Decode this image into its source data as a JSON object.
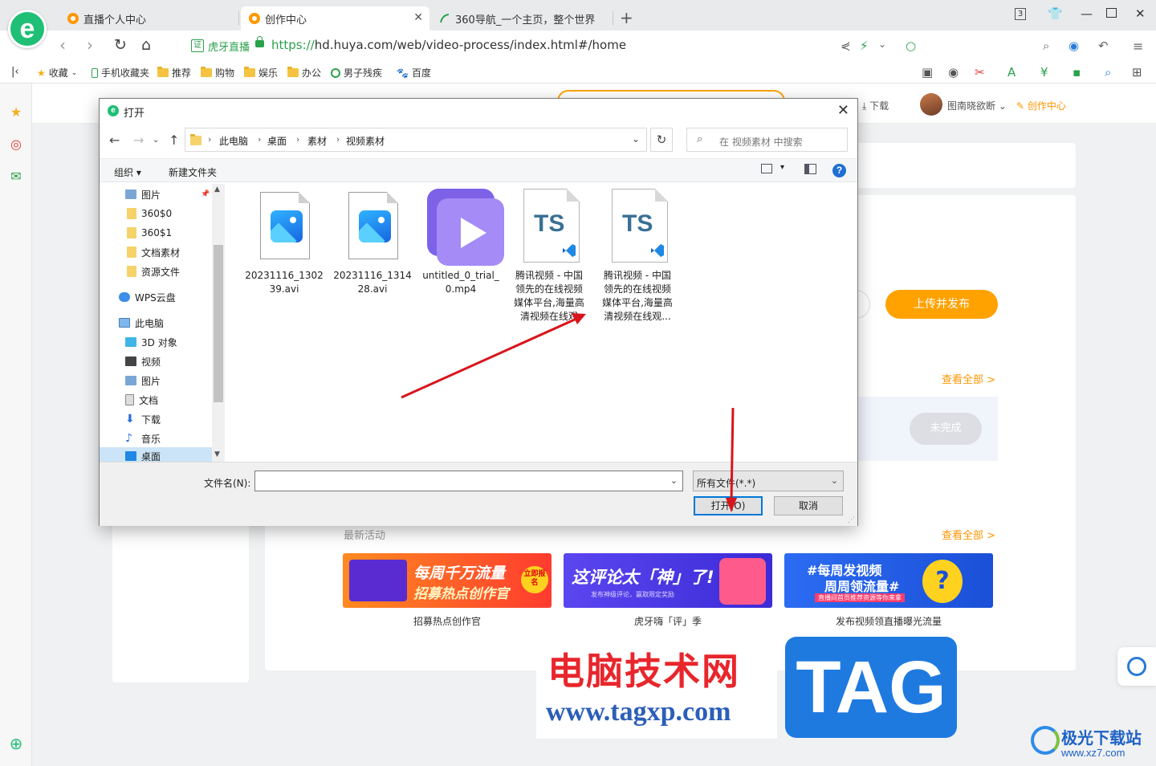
{
  "browser": {
    "tabs": [
      {
        "label": "直播个人中心"
      },
      {
        "label": "创作中心"
      },
      {
        "label": "360导航_一个主页，整个世界"
      }
    ],
    "tab_count": "3",
    "site_label": "虎牙直播",
    "url_protocol": "https://",
    "url_rest": "hd.huya.com/web/video-process/index.html#/home",
    "bookmarks": [
      "收藏",
      "手机收藏夹",
      "推荐",
      "购物",
      "娱乐",
      "办公",
      "男子残疾",
      "百度"
    ]
  },
  "page": {
    "header_links": {
      "download": "下载",
      "user": "图南晓欲断",
      "creator_center": "创作中心"
    },
    "upload_button": "上传并发布",
    "see_all_1": "查看全部 >",
    "see_all_2": "查看全部 >",
    "unfinished": "未完成",
    "latest_activities": "最新活动",
    "banners": [
      {
        "title": "每周千万流量",
        "sub": "招募热点创作官",
        "tag": "立即报名",
        "caption": "招募热点创作官"
      },
      {
        "title": "这评论太「神」了!",
        "sub": "发布神级评论，赢取限定奖励",
        "caption": "虎牙嗨「评」季"
      },
      {
        "title": "#每周发视频",
        "sub": "周周领流量#",
        "extra": "直播间首页推荐资源等你来拿",
        "caption": "发布视频领直播曝光流量"
      }
    ]
  },
  "dialog": {
    "title": "打开",
    "path": [
      "此电脑",
      "桌面",
      "素材",
      "视频素材"
    ],
    "search_placeholder": "在 视频素材 中搜索",
    "toolbar": {
      "organize": "组织",
      "new_folder": "新建文件夹"
    },
    "tree": [
      {
        "label": "图片",
        "icon": "picture-folder"
      },
      {
        "label": "360$0",
        "icon": "folder"
      },
      {
        "label": "360$1",
        "icon": "folder"
      },
      {
        "label": "文档素材",
        "icon": "folder"
      },
      {
        "label": "资源文件",
        "icon": "folder"
      },
      {
        "label": "WPS云盘",
        "icon": "cloud"
      },
      {
        "label": "此电脑",
        "icon": "computer"
      },
      {
        "label": "3D 对象",
        "icon": "3d-objects"
      },
      {
        "label": "视频",
        "icon": "video-folder"
      },
      {
        "label": "图片",
        "icon": "picture-folder"
      },
      {
        "label": "文档",
        "icon": "documents-folder"
      },
      {
        "label": "下载",
        "icon": "download-folder"
      },
      {
        "label": "音乐",
        "icon": "music-folder"
      },
      {
        "label": "桌面",
        "icon": "desktop-folder",
        "selected": true
      }
    ],
    "files": [
      {
        "name_lines": [
          "20231116_1302",
          "39.avi"
        ],
        "type": "image"
      },
      {
        "name_lines": [
          "20231116_1314",
          "28.avi"
        ],
        "type": "image"
      },
      {
        "name_lines": [
          "untitled_0_trial_",
          "0.mp4"
        ],
        "type": "video"
      },
      {
        "name_lines": [
          "腾讯视频 - 中国",
          "领先的在线视频",
          "媒体平台,海量高",
          "清视频在线观"
        ],
        "type": "ts"
      },
      {
        "name_lines": [
          "腾讯视频 - 中国",
          "领先的在线视频",
          "媒体平台,海量高",
          "清视频在线观..."
        ],
        "type": "ts"
      }
    ],
    "filename_label": "文件名(N):",
    "filename_value": "",
    "filetype": "所有文件(*.*)",
    "open_button": "打开(O)",
    "cancel_button": "取消"
  },
  "watermark": {
    "cn": "电脑技术网",
    "url": "www.tagxp.com",
    "tag": "TAG",
    "site_cn": "极光下载站",
    "site_url": "www.xz7.com"
  },
  "colors": {
    "accent_orange": "#ffa200",
    "dialog_primary": "#0078d7",
    "annotation_red": "#d9141b"
  }
}
